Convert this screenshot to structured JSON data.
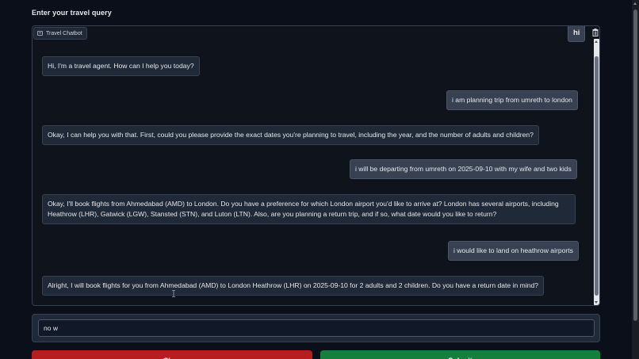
{
  "query_label": "Enter your travel query",
  "chatbot": {
    "label": "Travel Chatbot",
    "messages": [
      {
        "role": "user",
        "text": "hi"
      },
      {
        "role": "bot",
        "text": "Hi, I'm a travel agent. How can I help you today?"
      },
      {
        "role": "user",
        "text": "i am planning trip from umreth to london"
      },
      {
        "role": "bot",
        "text": "Okay, I can help you with that. First, could you please provide the exact dates you're planning to travel, including the year, and the number of adults and children?"
      },
      {
        "role": "user",
        "text": "i will be departing from umreth on 2025-09-10 with my wife and two kids"
      },
      {
        "role": "bot",
        "text": "Okay, I'll book flights from Ahmedabad (AMD) to London. Do you have a preference for which London airport you'd like to arrive at? London has several airports, including Heathrow (LHR), Gatwick (LGW), Stansted (STN), and Luton (LTN). Also, are you planning a return trip, and if so, what date would you like to return?"
      },
      {
        "role": "user",
        "text": "i would like to land on heathrow airports"
      },
      {
        "role": "bot",
        "text": "Alright, I will book flights for you from Ahmedabad (AMD) to London Heathrow (LHR) on 2025-09-10 for 2 adults and 2 children. Do you have a return date in mind?"
      }
    ]
  },
  "input": {
    "value": "no w"
  },
  "buttons": {
    "clear_label": "Clear",
    "submit_label": "Submit"
  },
  "colors": {
    "background": "#0b0f19",
    "clear_button": "#b91c1c",
    "submit_button": "#15803d"
  }
}
